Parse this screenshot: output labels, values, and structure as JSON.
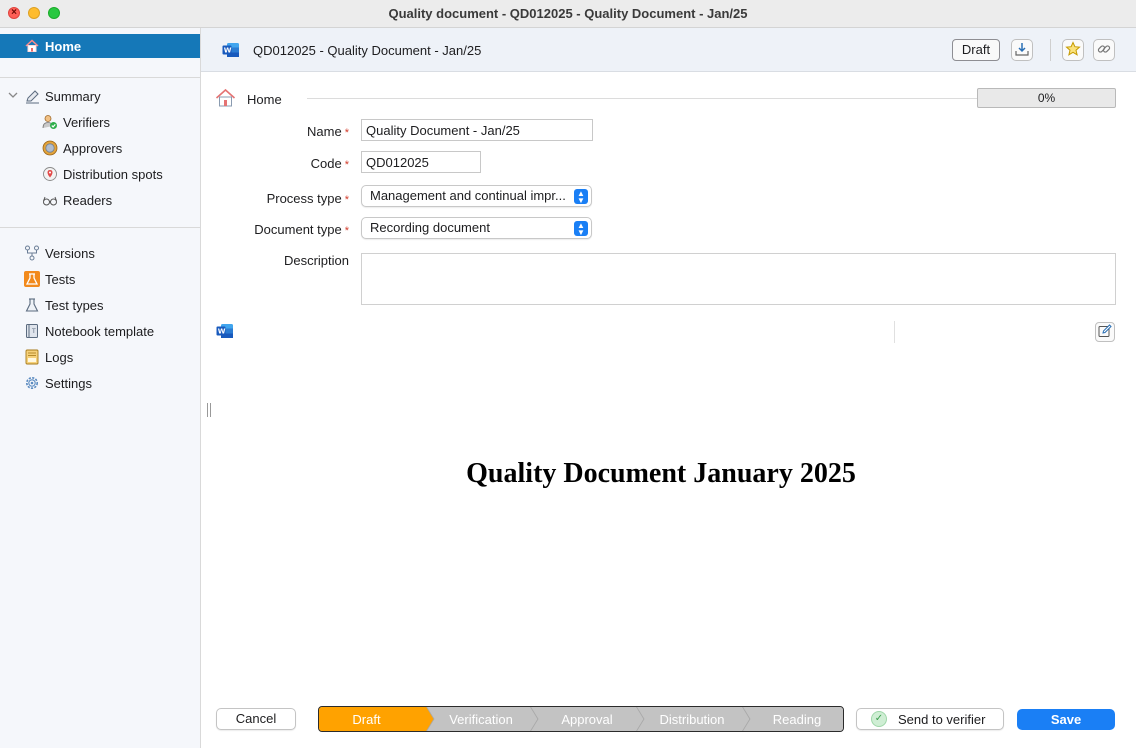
{
  "window": {
    "title": "Quality document - QD012025 - Quality Document - Jan/25"
  },
  "sidebar": {
    "home": "Home",
    "summary": "Summary",
    "summary_children": [
      "Verifiers",
      "Approvers",
      "Distribution spots",
      "Readers"
    ],
    "items": [
      "Versions",
      "Tests",
      "Test types",
      "Notebook template",
      "Logs",
      "Settings"
    ]
  },
  "header": {
    "title": "QD012025 - Quality Document - Jan/25",
    "status_button": "Draft"
  },
  "breadcrumb": {
    "label": "Home",
    "progress": "0%"
  },
  "form": {
    "name_label": "Name",
    "name_value": "Quality Document - Jan/25",
    "code_label": "Code",
    "code_value": "QD012025",
    "process_type_label": "Process type",
    "process_type_value": "Management and continual impr...",
    "document_type_label": "Document type",
    "document_type_value": "Recording document",
    "description_label": "Description",
    "required_marker": "*"
  },
  "document": {
    "title": "Quality Document January 2025"
  },
  "footer": {
    "cancel": "Cancel",
    "workflow": [
      "Draft",
      "Verification",
      "Approval",
      "Distribution",
      "Reading"
    ],
    "workflow_active_index": 0,
    "send": "Send to verifier",
    "save": "Save"
  },
  "colors": {
    "accent_blue": "#1a7ff5",
    "sidebar_selected": "#1578b8",
    "workflow_active": "#ffa200",
    "workflow_inactive": "#bdbdbd"
  }
}
